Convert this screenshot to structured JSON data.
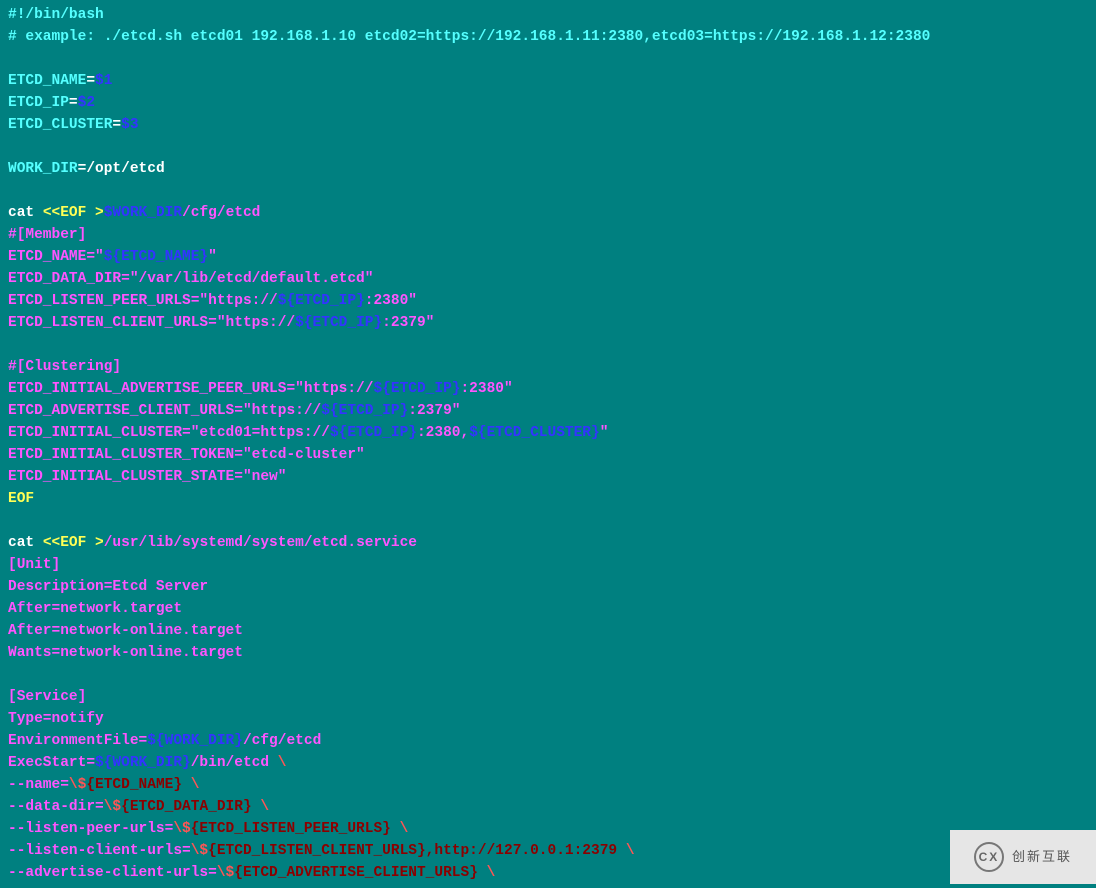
{
  "lines": [
    [
      {
        "t": "#!/bin/bash",
        "c": "c-cyan"
      }
    ],
    [
      {
        "t": "# example: ./etcd.sh etcd01 192.168.1.10 etcd02=https://192.168.1.11:2380,etcd03=https://192.168.1.12:2380",
        "c": "c-cyan"
      }
    ],
    [
      {
        "t": "",
        "c": "c-white"
      }
    ],
    [
      {
        "t": "ETCD_NAME",
        "c": "c-cyan"
      },
      {
        "t": "=",
        "c": "c-white"
      },
      {
        "t": "$1",
        "c": "c-blue"
      }
    ],
    [
      {
        "t": "ETCD_IP",
        "c": "c-cyan"
      },
      {
        "t": "=",
        "c": "c-white"
      },
      {
        "t": "$2",
        "c": "c-blue"
      }
    ],
    [
      {
        "t": "ETCD_CLUSTER",
        "c": "c-cyan"
      },
      {
        "t": "=",
        "c": "c-white"
      },
      {
        "t": "$3",
        "c": "c-blue"
      }
    ],
    [
      {
        "t": "",
        "c": "c-white"
      }
    ],
    [
      {
        "t": "WORK_DIR",
        "c": "c-cyan"
      },
      {
        "t": "=/opt/etcd",
        "c": "c-white"
      }
    ],
    [
      {
        "t": "",
        "c": "c-white"
      }
    ],
    [
      {
        "t": "cat ",
        "c": "c-white"
      },
      {
        "t": "<<EOF >",
        "c": "c-yellow"
      },
      {
        "t": "$WORK_DIR",
        "c": "c-blue"
      },
      {
        "t": "/cfg/etcd",
        "c": "c-magenta"
      }
    ],
    [
      {
        "t": "#[Member]",
        "c": "c-magenta"
      }
    ],
    [
      {
        "t": "ETCD_NAME=\"",
        "c": "c-magenta"
      },
      {
        "t": "${ETCD_NAME}",
        "c": "c-blue"
      },
      {
        "t": "\"",
        "c": "c-magenta"
      }
    ],
    [
      {
        "t": "ETCD_DATA_DIR=\"/var/lib/etcd/default.etcd\"",
        "c": "c-magenta"
      }
    ],
    [
      {
        "t": "ETCD_LISTEN_PEER_URLS=\"https://",
        "c": "c-magenta"
      },
      {
        "t": "${ETCD_IP}",
        "c": "c-blue"
      },
      {
        "t": ":2380\"",
        "c": "c-magenta"
      }
    ],
    [
      {
        "t": "ETCD_LISTEN_CLIENT_URLS=\"https://",
        "c": "c-magenta"
      },
      {
        "t": "${ETCD_IP}",
        "c": "c-blue"
      },
      {
        "t": ":2379\"",
        "c": "c-magenta"
      }
    ],
    [
      {
        "t": "",
        "c": "c-white"
      }
    ],
    [
      {
        "t": "#[Clustering]",
        "c": "c-magenta"
      }
    ],
    [
      {
        "t": "ETCD_INITIAL_ADVERTISE_PEER_URLS=\"https://",
        "c": "c-magenta"
      },
      {
        "t": "${ETCD_IP}",
        "c": "c-blue"
      },
      {
        "t": ":2380\"",
        "c": "c-magenta"
      }
    ],
    [
      {
        "t": "ETCD_ADVERTISE_CLIENT_URLS=\"https://",
        "c": "c-magenta"
      },
      {
        "t": "${ETCD_IP}",
        "c": "c-blue"
      },
      {
        "t": ":2379\"",
        "c": "c-magenta"
      }
    ],
    [
      {
        "t": "ETCD_INITIAL_CLUSTER=\"etcd01=https://",
        "c": "c-magenta"
      },
      {
        "t": "${ETCD_IP}",
        "c": "c-blue"
      },
      {
        "t": ":2380,",
        "c": "c-magenta"
      },
      {
        "t": "${ETCD_CLUSTER}",
        "c": "c-blue"
      },
      {
        "t": "\"",
        "c": "c-magenta"
      }
    ],
    [
      {
        "t": "ETCD_INITIAL_CLUSTER_TOKEN=\"etcd-cluster\"",
        "c": "c-magenta"
      }
    ],
    [
      {
        "t": "ETCD_INITIAL_CLUSTER_STATE=\"new\"",
        "c": "c-magenta"
      }
    ],
    [
      {
        "t": "EOF",
        "c": "c-yellow"
      }
    ],
    [
      {
        "t": "",
        "c": "c-white"
      }
    ],
    [
      {
        "t": "cat ",
        "c": "c-white"
      },
      {
        "t": "<<EOF >",
        "c": "c-yellow"
      },
      {
        "t": "/usr/lib/systemd/system/etcd.service",
        "c": "c-magenta"
      }
    ],
    [
      {
        "t": "[Unit]",
        "c": "c-magenta"
      }
    ],
    [
      {
        "t": "Description=Etcd Server",
        "c": "c-magenta"
      }
    ],
    [
      {
        "t": "After=network.target",
        "c": "c-magenta"
      }
    ],
    [
      {
        "t": "After=network-online.target",
        "c": "c-magenta"
      }
    ],
    [
      {
        "t": "Wants=network-online.target",
        "c": "c-magenta"
      }
    ],
    [
      {
        "t": "",
        "c": "c-white"
      }
    ],
    [
      {
        "t": "[Service]",
        "c": "c-magenta"
      }
    ],
    [
      {
        "t": "Type=notify",
        "c": "c-magenta"
      }
    ],
    [
      {
        "t": "EnvironmentFile=",
        "c": "c-magenta"
      },
      {
        "t": "${WORK_DIR}",
        "c": "c-blue"
      },
      {
        "t": "/cfg/etcd",
        "c": "c-magenta"
      }
    ],
    [
      {
        "t": "ExecStart=",
        "c": "c-magenta"
      },
      {
        "t": "${WORK_DIR}",
        "c": "c-blue"
      },
      {
        "t": "/bin/etcd ",
        "c": "c-magenta"
      },
      {
        "t": "\\",
        "c": "c-red"
      }
    ],
    [
      {
        "t": "--name=",
        "c": "c-magenta"
      },
      {
        "t": "\\$",
        "c": "c-red"
      },
      {
        "t": "{ETCD_NAME} ",
        "c": "c-darkred"
      },
      {
        "t": "\\",
        "c": "c-red"
      }
    ],
    [
      {
        "t": "--data-dir=",
        "c": "c-magenta"
      },
      {
        "t": "\\$",
        "c": "c-red"
      },
      {
        "t": "{ETCD_DATA_DIR} ",
        "c": "c-darkred"
      },
      {
        "t": "\\",
        "c": "c-red"
      }
    ],
    [
      {
        "t": "--listen-peer-urls=",
        "c": "c-magenta"
      },
      {
        "t": "\\$",
        "c": "c-red"
      },
      {
        "t": "{ETCD_LISTEN_PEER_URLS} ",
        "c": "c-darkred"
      },
      {
        "t": "\\",
        "c": "c-red"
      }
    ],
    [
      {
        "t": "--listen-client-urls=",
        "c": "c-magenta"
      },
      {
        "t": "\\$",
        "c": "c-red"
      },
      {
        "t": "{ETCD_LISTEN_CLIENT_URLS},http://127.0.0.1:2379 ",
        "c": "c-darkred"
      },
      {
        "t": "\\",
        "c": "c-red"
      }
    ],
    [
      {
        "t": "--advertise-client-urls=",
        "c": "c-magenta"
      },
      {
        "t": "\\$",
        "c": "c-red"
      },
      {
        "t": "{ETCD_ADVERTISE_CLIENT_URLS} ",
        "c": "c-darkred"
      },
      {
        "t": "\\",
        "c": "c-red"
      }
    ]
  ],
  "watermark": {
    "logo_text": "CX",
    "brand_text": "创新互联"
  }
}
